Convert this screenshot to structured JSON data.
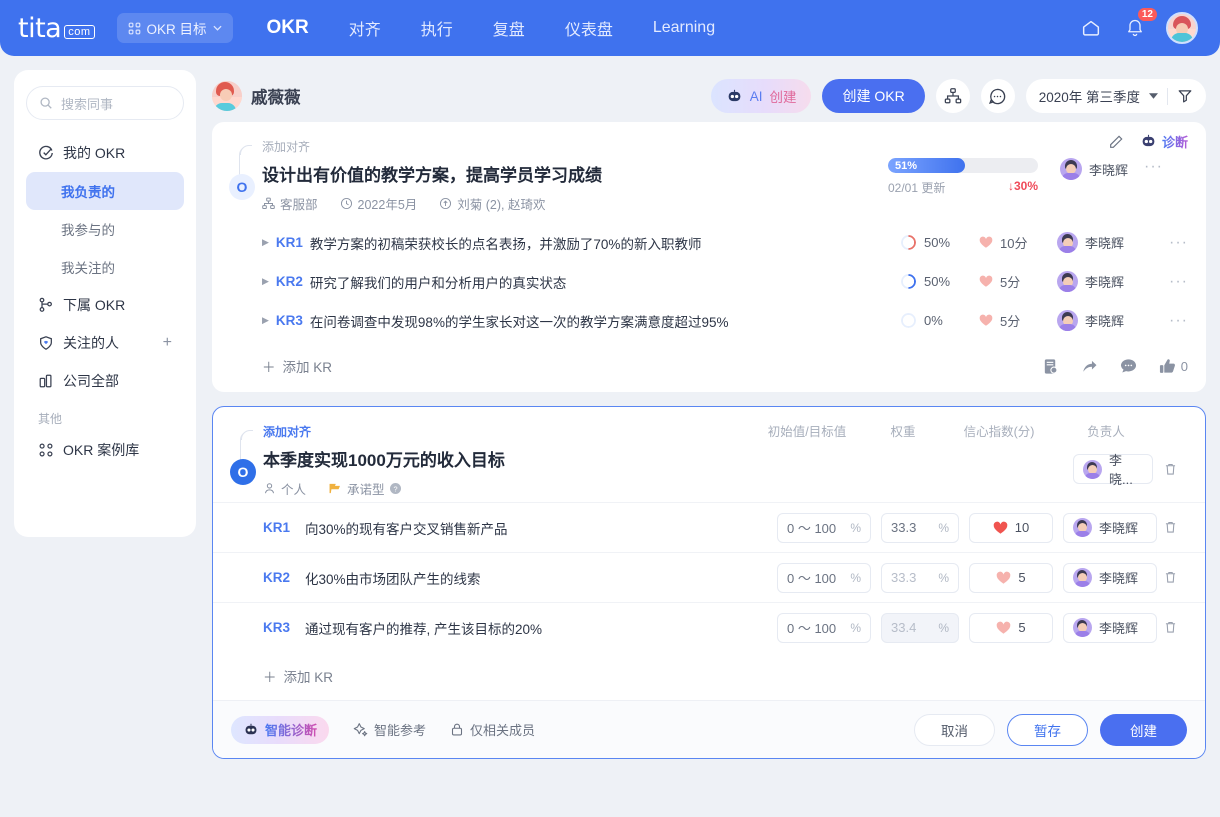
{
  "topnav": {
    "logo_word": "tita",
    "logo_suffix": "com",
    "selector_label": "OKR 目标",
    "items": [
      {
        "label": "OKR",
        "active": true
      },
      {
        "label": "对齐",
        "active": false
      },
      {
        "label": "执行",
        "active": false
      },
      {
        "label": "复盘",
        "active": false
      },
      {
        "label": "仪表盘",
        "active": false
      },
      {
        "label": "Learning",
        "active": false
      }
    ],
    "home_icon": "home-icon",
    "bell_icon": "bell-icon",
    "notification_count": "12",
    "avatar_icon": "user-avatar"
  },
  "sidebar": {
    "search_placeholder": "搜索同事",
    "items": [
      {
        "label": "我的 OKR",
        "icon": "target-check-icon",
        "level": "top",
        "active": false
      },
      {
        "label": "我负责的",
        "icon": "",
        "level": "sub",
        "active": true
      },
      {
        "label": "我参与的",
        "icon": "",
        "level": "sub",
        "active": false
      },
      {
        "label": "我关注的",
        "icon": "",
        "level": "sub",
        "active": false
      },
      {
        "label": "下属 OKR",
        "icon": "org-tree-icon",
        "level": "top",
        "active": false
      },
      {
        "label": "关注的人",
        "icon": "heart-shield-icon",
        "level": "top",
        "active": false,
        "trailing": "+"
      },
      {
        "label": "公司全部",
        "icon": "building-icon",
        "level": "top",
        "active": false
      }
    ],
    "group_label": "其他",
    "other_items": [
      {
        "label": "OKR 案例库",
        "icon": "grid-icon"
      }
    ]
  },
  "toolbar": {
    "user_name": "戚薇薇",
    "ai_create_prefix": "AI",
    "ai_create_suffix": "创建",
    "create_okr_label": "创建 OKR",
    "tree_icon": "org-chart-icon",
    "comment_icon": "comment-icon",
    "quarter_label": "2020年 第三季度",
    "filter_icon": "filter-icon"
  },
  "card1": {
    "align_link": "添加对齐",
    "objective_badge": "O",
    "title": "设计出有价值的教学方案，提高学员学习成绩",
    "meta": {
      "dept_icon": "org-tree-icon",
      "dept": "客服部",
      "time_icon": "clock-icon",
      "time": "2022年5月",
      "people_icon": "person-arrow-icon",
      "people": "刘菊 (2), 赵琦欢"
    },
    "edit_icon": "pencil-icon",
    "diagnose_icon": "robot-icon",
    "diagnose_label": "诊断",
    "progress_percent": "51%",
    "progress_value": 51,
    "updated_label": "02/01 更新",
    "trend_label": "↓30%",
    "owner": "李晓辉",
    "more_icon": "more-dots-icon",
    "krs": [
      {
        "tag": "KR1",
        "text": "教学方案的初稿荣获校长的点名表扬，并激励了70%的新入职教师",
        "progress": "50%",
        "ring_value": 50,
        "ring_color": "#e8736a",
        "score": "10分",
        "owner": "李晓辉"
      },
      {
        "tag": "KR2",
        "text": "研究了解我们的用户和分析用户的真实状态",
        "progress": "50%",
        "ring_value": 50,
        "ring_color": "#3f72ee",
        "score": "5分",
        "owner": "李晓辉"
      },
      {
        "tag": "KR3",
        "text": "在问卷调查中发现98%的学生家长对这一次的教学方案满意度超过95%",
        "progress": "0%",
        "ring_value": 0,
        "ring_color": "#c9dbff",
        "score": "5分",
        "owner": "李晓辉"
      }
    ],
    "add_kr_label": "添加 KR",
    "foot_icons": [
      {
        "name": "task-icon",
        "label": ""
      },
      {
        "name": "share-icon",
        "label": ""
      },
      {
        "name": "comment-icon",
        "label": ""
      },
      {
        "name": "thumbs-up-icon",
        "label": "0"
      }
    ]
  },
  "card2": {
    "align_link": "添加对齐",
    "objective_badge": "O",
    "title": "本季度实现1000万元的收入目标",
    "meta": {
      "scope_icon": "person-icon",
      "scope": "个人",
      "type_icon": "flag-icon",
      "type": "承诺型",
      "help_icon": "help-icon"
    },
    "column_headers": [
      "初始值/目标值",
      "权重",
      "信心指数(分)",
      "负责人"
    ],
    "objective_owner": "李晓...",
    "delete_icon": "trash-icon",
    "krs": [
      {
        "tag": "KR1",
        "text": "向30%的现有客户交叉销售新产品",
        "range": "0 ～ 100",
        "range_unit": "%",
        "weight": "33.3",
        "weight_unit": "%",
        "weight_state": "normal",
        "confidence": "10",
        "heart_color": "#f0544f",
        "owner": "李晓辉"
      },
      {
        "tag": "KR2",
        "text": "化30%由市场团队产生的线索",
        "range": "0 ～ 100",
        "range_unit": "%",
        "weight": "33.3",
        "weight_unit": "%",
        "weight_state": "dim",
        "confidence": "5",
        "heart_color": "#f6b2ad",
        "owner": "李晓辉"
      },
      {
        "tag": "KR3",
        "text": "通过现有客户的推荐, 产生该目标的20%",
        "range": "0 ～ 100",
        "range_unit": "%",
        "weight": "33.4",
        "weight_unit": "%",
        "weight_state": "dim2",
        "confidence": "5",
        "heart_color": "#f6b2ad",
        "owner": "李晓辉"
      }
    ],
    "add_kr_label": "添加 KR",
    "footer": {
      "smart_diagnose_icon": "robot-icon",
      "smart_diagnose_label": "智能诊断",
      "smart_ref_icon": "sparkle-icon",
      "smart_ref_label": "智能参考",
      "privacy_icon": "lock-icon",
      "privacy_label": "仅相关成员",
      "cancel_label": "取消",
      "draft_label": "暂存",
      "create_label": "创建"
    }
  },
  "colors": {
    "brand_blue": "#3f72ee",
    "accent_blue": "#4a6ff0",
    "danger": "#ef4a59",
    "bg": "#eef1f6"
  }
}
